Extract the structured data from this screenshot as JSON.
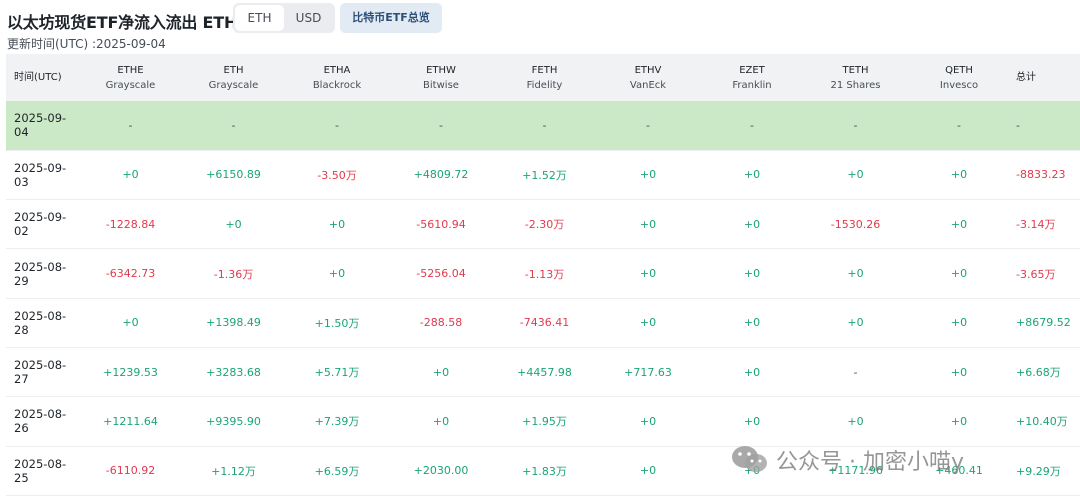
{
  "header": {
    "title": "以太坊现货ETF净流入流出 ETH",
    "updated": "更新时间(UTC) :2025-09-04",
    "unit_toggle": {
      "options": [
        "ETH",
        "USD"
      ],
      "selected": "ETH"
    },
    "overview_button": "比特币ETF总览"
  },
  "table": {
    "columns": [
      {
        "ticker": "时间(UTC)",
        "issuer": ""
      },
      {
        "ticker": "ETHE",
        "issuer": "Grayscale"
      },
      {
        "ticker": "ETH",
        "issuer": "Grayscale"
      },
      {
        "ticker": "ETHA",
        "issuer": "Blackrock"
      },
      {
        "ticker": "ETHW",
        "issuer": "Bitwise"
      },
      {
        "ticker": "FETH",
        "issuer": "Fidelity"
      },
      {
        "ticker": "ETHV",
        "issuer": "VanEck"
      },
      {
        "ticker": "EZET",
        "issuer": "Franklin"
      },
      {
        "ticker": "TETH",
        "issuer": "21 Shares"
      },
      {
        "ticker": "QETH",
        "issuer": "Invesco"
      },
      {
        "ticker": "总计",
        "issuer": ""
      }
    ],
    "rows": [
      {
        "date": "2025-09-04",
        "values": [
          "-",
          "-",
          "-",
          "-",
          "-",
          "-",
          "-",
          "-",
          "-",
          "-"
        ],
        "highlight": true
      },
      {
        "date": "2025-09-03",
        "values": [
          "+0",
          "+6150.89",
          "-3.50万",
          "+4809.72",
          "+1.52万",
          "+0",
          "+0",
          "+0",
          "+0",
          "-8833.23"
        ]
      },
      {
        "date": "2025-09-02",
        "values": [
          "-1228.84",
          "+0",
          "+0",
          "-5610.94",
          "-2.30万",
          "+0",
          "+0",
          "-1530.26",
          "+0",
          "-3.14万"
        ]
      },
      {
        "date": "2025-08-29",
        "values": [
          "-6342.73",
          "-1.36万",
          "+0",
          "-5256.04",
          "-1.13万",
          "+0",
          "+0",
          "+0",
          "+0",
          "-3.65万"
        ]
      },
      {
        "date": "2025-08-28",
        "values": [
          "+0",
          "+1398.49",
          "+1.50万",
          "-288.58",
          "-7436.41",
          "+0",
          "+0",
          "+0",
          "+0",
          "+8679.52"
        ]
      },
      {
        "date": "2025-08-27",
        "values": [
          "+1239.53",
          "+3283.68",
          "+5.71万",
          "+0",
          "+4457.98",
          "+717.63",
          "+0",
          "-",
          "+0",
          "+6.68万"
        ]
      },
      {
        "date": "2025-08-26",
        "values": [
          "+1211.64",
          "+9395.90",
          "+7.39万",
          "+0",
          "+1.95万",
          "+0",
          "+0",
          "+0",
          "+0",
          "+10.40万"
        ]
      },
      {
        "date": "2025-08-25",
        "values": [
          "-6110.92",
          "+1.12万",
          "+6.59万",
          "+2030.00",
          "+1.83万",
          "+0",
          "+0",
          "+1171.96",
          "+460.41",
          "+9.29万"
        ]
      }
    ]
  },
  "watermark": {
    "text": "公众号 · 加密小喵y",
    "icon": "wechat-icon"
  },
  "colors": {
    "positive": "#1ba37a",
    "negative": "#e03a4e",
    "highlight_row": "#cbe9c7",
    "header_bg": "#f1f2f4"
  }
}
